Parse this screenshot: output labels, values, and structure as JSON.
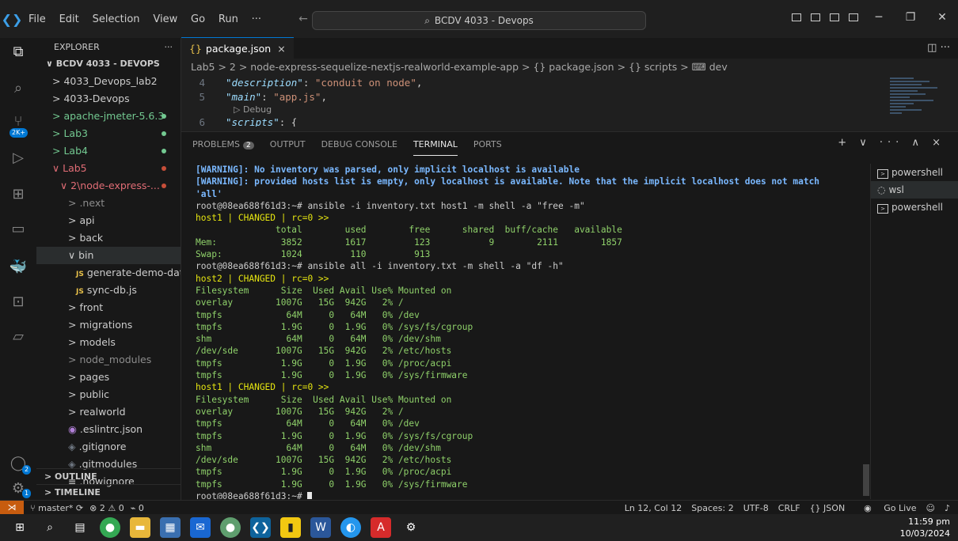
{
  "titlebar": {
    "menu": [
      "File",
      "Edit",
      "Selection",
      "View",
      "Go",
      "Run",
      "···"
    ],
    "search_text": "BCDV 4033 - Devops"
  },
  "activity": {
    "scm_badge": "2K+",
    "accounts_badge": "2",
    "settings_badge": "1"
  },
  "sidebar": {
    "title": "EXPLORER",
    "more": "···",
    "root": "BCDV 4033 - DEVOPS",
    "items": [
      {
        "label": "> 4033_Devops_lab2",
        "indent": 1
      },
      {
        "label": "> 4033-Devops",
        "indent": 1
      },
      {
        "label": "> apache-jmeter-5.6.3",
        "indent": 1,
        "color": "#73c991",
        "dot": "#73c991"
      },
      {
        "label": "> Lab3",
        "indent": 1,
        "color": "#73c991",
        "dot": "#73c991"
      },
      {
        "label": "> Lab4",
        "indent": 1,
        "color": "#73c991",
        "dot": "#73c991"
      },
      {
        "label": "∨ Lab5",
        "indent": 1,
        "color": "#e06c75",
        "dot": "#c74e39"
      },
      {
        "label": "∨ 2\\node-express-...",
        "indent": 2,
        "color": "#e06c75",
        "dot": "#c74e39"
      },
      {
        "label": "> .next",
        "indent": 3,
        "color": "#8c8c8c"
      },
      {
        "label": "> api",
        "indent": 3
      },
      {
        "label": "> back",
        "indent": 3
      },
      {
        "label": "∨ bin",
        "indent": 3,
        "selected": true
      },
      {
        "label": "generate-demo-dat...",
        "indent": 4,
        "js": "JS"
      },
      {
        "label": "sync-db.js",
        "indent": 4,
        "js": "JS"
      },
      {
        "label": "> front",
        "indent": 3
      },
      {
        "label": "> migrations",
        "indent": 3
      },
      {
        "label": "> models",
        "indent": 3
      },
      {
        "label": "> node_modules",
        "indent": 3,
        "color": "#8c8c8c"
      },
      {
        "label": "> pages",
        "indent": 3
      },
      {
        "label": "> public",
        "indent": 3
      },
      {
        "label": "> realworld",
        "indent": 3
      },
      {
        "label": ".eslintrc.json",
        "indent": 3,
        "prefix": "◉ ",
        "prefix_color": "#b180d7"
      },
      {
        "label": ".gitignore",
        "indent": 3,
        "prefix": "◈ ",
        "prefix_color": "#6e7681"
      },
      {
        "label": ".gitmodules",
        "indent": 3,
        "prefix": "◈ ",
        "prefix_color": "#6e7681"
      },
      {
        "label": ".nowignore",
        "indent": 3,
        "prefix": "≡ ",
        "prefix_color": "#cccccc"
      }
    ],
    "outline": "> OUTLINE",
    "timeline": "> TIMELINE"
  },
  "editor": {
    "tab_label": "package.json",
    "tab_icon": "{}",
    "tab_close": "×",
    "breadcrumb": "Lab5 > 2 > node-express-sequelize-nextjs-realworld-example-app > {} package.json > {} scripts > ⌨ dev",
    "lines": [
      {
        "num": "4",
        "key": "\"description\"",
        "rest": ": ",
        "val": "\"conduit on node\"",
        "end": ","
      },
      {
        "num": "5",
        "key": "\"main\"",
        "rest": ": ",
        "val": "\"app.js\"",
        "end": ","
      }
    ],
    "codelens": "▷ Debug",
    "partial_line": {
      "num": "6",
      "key": "\"scripts\"",
      "rest": ": {"
    }
  },
  "panel": {
    "tabs": [
      "PROBLEMS",
      "OUTPUT",
      "DEBUG CONSOLE",
      "TERMINAL",
      "PORTS"
    ],
    "problems_count": "2",
    "active_tab": "TERMINAL",
    "actions": "+ ∨ ··· ∧ ×",
    "terminals": [
      {
        "label": "powershell",
        "icon": ">_"
      },
      {
        "label": "wsl",
        "icon": "◌",
        "active": true
      },
      {
        "label": "powershell",
        "icon": ">_"
      }
    ]
  },
  "terminal_lines": [
    {
      "t": "[WARNING]: No inventory was parsed, only implicit localhost is available",
      "c": "warn"
    },
    {
      "t": "[WARNING]: provided hosts list is empty, only localhost is available. Note that the implicit localhost does not match",
      "c": "warn"
    },
    {
      "t": "'all'",
      "c": "warn"
    },
    {
      "t": "root@08ea688f61d3:~# ansible -i inventory.txt host1 -m shell -a \"free -m\"",
      "c": ""
    },
    {
      "t": "host1 | CHANGED | rc=0 >>",
      "c": "yellow"
    },
    {
      "t": "               total        used        free      shared  buff/cache   available",
      "c": "green"
    },
    {
      "t": "Mem:            3852        1617         123           9        2111        1857",
      "c": "green"
    },
    {
      "t": "Swap:           1024         110         913",
      "c": "green"
    },
    {
      "t": "root@08ea688f61d3:~# ansible all -i inventory.txt -m shell -a \"df -h\"",
      "c": ""
    },
    {
      "t": "host2 | CHANGED | rc=0 >>",
      "c": "yellow"
    },
    {
      "t": "Filesystem      Size  Used Avail Use% Mounted on",
      "c": "green"
    },
    {
      "t": "overlay        1007G   15G  942G   2% /",
      "c": "green"
    },
    {
      "t": "tmpfs            64M     0   64M   0% /dev",
      "c": "green"
    },
    {
      "t": "tmpfs           1.9G     0  1.9G   0% /sys/fs/cgroup",
      "c": "green"
    },
    {
      "t": "shm              64M     0   64M   0% /dev/shm",
      "c": "green"
    },
    {
      "t": "/dev/sde       1007G   15G  942G   2% /etc/hosts",
      "c": "green"
    },
    {
      "t": "tmpfs           1.9G     0  1.9G   0% /proc/acpi",
      "c": "green"
    },
    {
      "t": "tmpfs           1.9G     0  1.9G   0% /sys/firmware",
      "c": "green"
    },
    {
      "t": "host1 | CHANGED | rc=0 >>",
      "c": "yellow"
    },
    {
      "t": "Filesystem      Size  Used Avail Use% Mounted on",
      "c": "green"
    },
    {
      "t": "overlay        1007G   15G  942G   2% /",
      "c": "green"
    },
    {
      "t": "tmpfs            64M     0   64M   0% /dev",
      "c": "green"
    },
    {
      "t": "tmpfs           1.9G     0  1.9G   0% /sys/fs/cgroup",
      "c": "green"
    },
    {
      "t": "shm              64M     0   64M   0% /dev/shm",
      "c": "green"
    },
    {
      "t": "/dev/sde       1007G   15G  942G   2% /etc/hosts",
      "c": "green"
    },
    {
      "t": "tmpfs           1.9G     0  1.9G   0% /proc/acpi",
      "c": "green"
    },
    {
      "t": "tmpfs           1.9G     0  1.9G   0% /sys/firmware",
      "c": "green"
    }
  ],
  "prompt": "root@08ea688f61d3:~# ",
  "statusbar": {
    "branch": "master*",
    "errors": "⊗ 2",
    "warnings": "⚠ 0",
    "ports": "0",
    "position": "Ln 12, Col 12",
    "spaces": "Spaces: 2",
    "encoding": "UTF-8",
    "eol": "CRLF",
    "language": "{} JSON",
    "golive": "Go Live"
  },
  "taskbar": {
    "time": "11:59 pm",
    "date": "10/03/2024"
  }
}
